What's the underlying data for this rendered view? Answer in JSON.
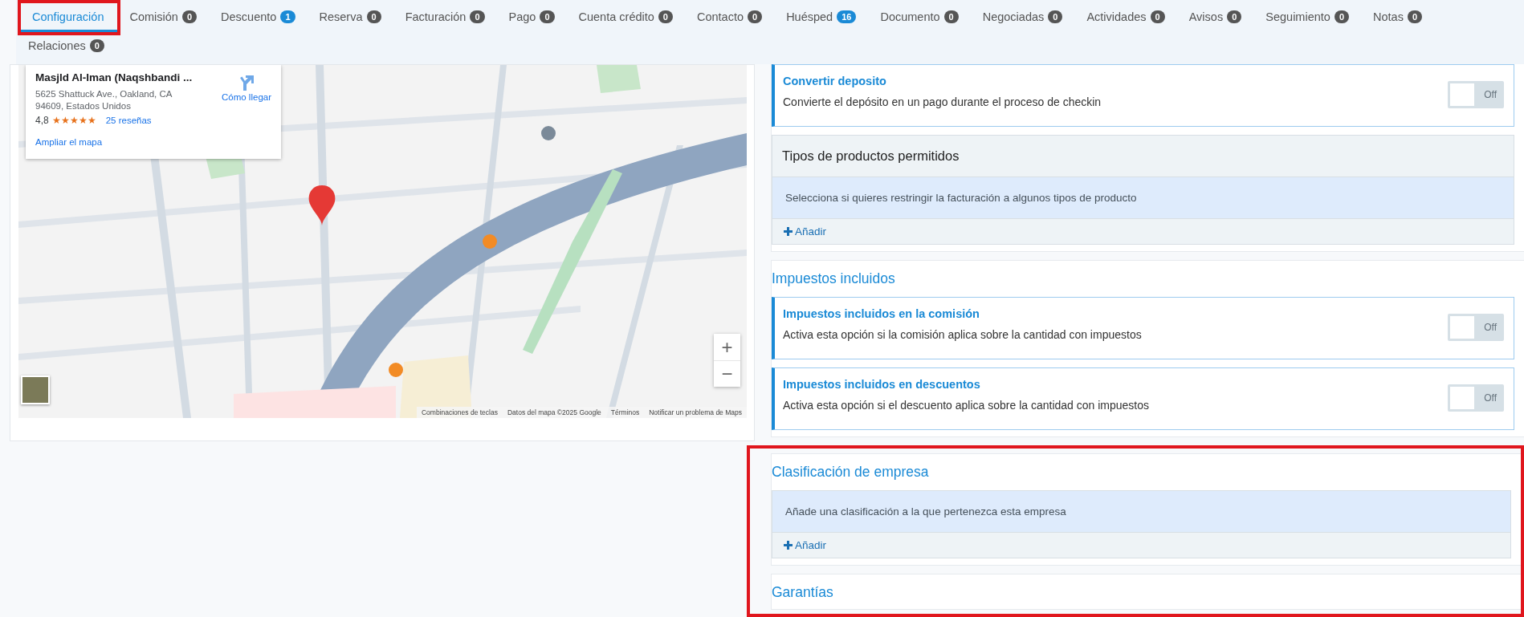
{
  "tabs": [
    {
      "label": "Configuración",
      "selected": true,
      "highlighted": true
    },
    {
      "label": "Comisión",
      "count": "0",
      "color": "#555555",
      "selected": false,
      "highlighted": false
    },
    {
      "label": "Descuento",
      "count": "1",
      "color": "#1a8ad6",
      "selected": false,
      "highlighted": false
    },
    {
      "label": "Reserva",
      "count": "0",
      "color": "#555555",
      "selected": false,
      "highlighted": false
    },
    {
      "label": "Facturación",
      "count": "0",
      "color": "#555555",
      "selected": false,
      "highlighted": false
    },
    {
      "label": "Pago",
      "count": "0",
      "color": "#555555",
      "selected": false,
      "highlighted": false
    },
    {
      "label": "Cuenta crédito",
      "count": "0",
      "color": "#555555",
      "selected": false,
      "highlighted": false
    },
    {
      "label": "Contacto",
      "count": "0",
      "color": "#555555",
      "selected": false,
      "highlighted": false
    },
    {
      "label": "Huésped",
      "count": "16",
      "color": "#1a8ad6",
      "selected": false,
      "highlighted": false
    },
    {
      "label": "Documento",
      "count": "0",
      "color": "#555555",
      "selected": false,
      "highlighted": false
    },
    {
      "label": "Negociadas",
      "count": "0",
      "color": "#555555",
      "selected": false,
      "highlighted": false
    },
    {
      "label": "Actividades",
      "count": "0",
      "color": "#555555",
      "selected": false,
      "highlighted": false
    },
    {
      "label": "Avisos",
      "count": "0",
      "color": "#555555",
      "selected": false,
      "highlighted": false
    },
    {
      "label": "Seguimiento",
      "count": "0",
      "color": "#555555",
      "selected": false,
      "highlighted": false
    },
    {
      "label": "Notas",
      "count": "0",
      "color": "#555555",
      "selected": false,
      "highlighted": false
    },
    {
      "label": "Relaciones",
      "count": "0",
      "color": "#555555",
      "selected": false,
      "highlighted": false
    }
  ],
  "map": {
    "kind": "picture",
    "place_card": {
      "name": "Masjld Al-Iman (Naqshbandi ...",
      "address": "5625 Shattuck Ave., Oakland, CA 94609, Estados Unidos",
      "rating": "4,8",
      "stars": 5,
      "reviews": "25 reseñas",
      "directions": "Cómo llegar",
      "enlarge": "Ampliar el mapa"
    },
    "zoom_in": "+",
    "zoom_out": "−",
    "attribution": [
      "Combinaciones de teclas",
      "Datos del mapa ©2025 Google",
      "Términos",
      "Notificar un problema de Maps"
    ]
  },
  "sections": [
    {
      "highlighted": false,
      "items": [
        {
          "kind": "toggle",
          "title": "Convertir deposito",
          "description": "Convierte el depósito en un pago durante el proceso de checkin",
          "on": false,
          "state_label": "Off"
        },
        {
          "kind": "list",
          "title": "Tipos de productos permitidos",
          "empty_text": "Selecciona si quieres restringir la facturación a algunos tipos de producto",
          "add_label": "Añadir"
        }
      ]
    },
    {
      "title": "Impuestos incluidos",
      "highlighted": false,
      "items": [
        {
          "kind": "toggle",
          "title": "Impuestos incluidos en la comisión",
          "description": "Activa esta opción si la comisión aplica sobre la cantidad con impuestos",
          "on": false,
          "state_label": "Off"
        },
        {
          "kind": "toggle",
          "title": "Impuestos incluidos en descuentos",
          "description": "Activa esta opción si el descuento aplica sobre la cantidad con impuestos",
          "on": false,
          "state_label": "Off"
        }
      ]
    },
    {
      "title": "Clasificación de empresa",
      "highlighted": true,
      "items": [
        {
          "kind": "list",
          "empty_text": "Añade una clasificación a la que pertenezca esta empresa",
          "add_label": "Añadir"
        }
      ]
    },
    {
      "title": "Garantías",
      "highlighted": true
    }
  ]
}
